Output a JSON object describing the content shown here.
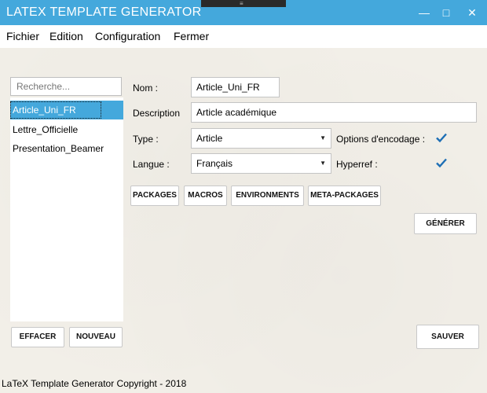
{
  "window": {
    "title": "LATEX TEMPLATE GENERATOR",
    "controls": {
      "minimize": "—",
      "maximize": "□",
      "close": "✕"
    },
    "grip_icon": "≡"
  },
  "menu": [
    "Fichier",
    "Edition",
    "Configuration",
    "Fermer"
  ],
  "search": {
    "placeholder": "Recherche..."
  },
  "templates": [
    "Article_Uni_FR",
    "Lettre_Officielle",
    "Presentation_Beamer"
  ],
  "selected_template": "Article_Uni_FR",
  "form": {
    "nom_label": "Nom :",
    "nom_value": "Article_Uni_FR",
    "description_label": "Description",
    "description_value": "Article académique",
    "type_label": "Type :",
    "type_value": "Article",
    "langue_label": "Langue :",
    "langue_value": "Français",
    "options_label": "Options d'encodage :",
    "options_checked": true,
    "hyperref_label": "Hyperref :",
    "hyperref_checked": true
  },
  "buttons": {
    "packages": "PACKAGES",
    "macros": "MACROS",
    "environments": "ENVIRONMENTS",
    "meta_packages": "META-PACKAGES",
    "generer": "GÉNÉRER",
    "effacer": "EFFACER",
    "nouveau": "NOUVEAU",
    "sauver": "SAUVER"
  },
  "footer": "LaTeX Template Generator Copyright - 2018",
  "colors": {
    "accent": "#44a8dc",
    "check": "#1e6fb5",
    "background": "#f2efe8"
  }
}
